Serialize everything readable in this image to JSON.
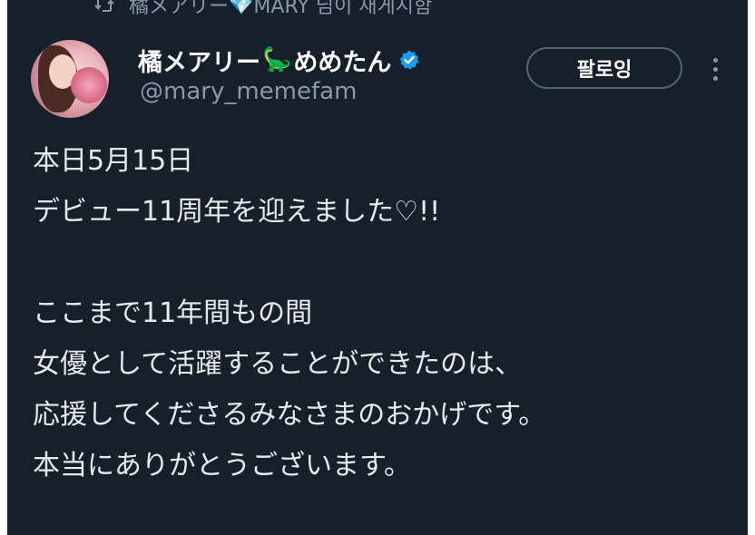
{
  "repost_banner": {
    "text_before": "橘メアリー",
    "gem_emoji": "💎",
    "text_after": "MARY 님이 재게시함"
  },
  "author": {
    "display_name": "橘メアリー",
    "name_emoji": "🦕",
    "display_name_suffix": "めめたん",
    "handle": "@mary_memefam",
    "verified": true,
    "verified_color": "#1d9bf0"
  },
  "actions": {
    "follow_label": "팔로잉"
  },
  "tweet": {
    "lines": [
      "本日5月15日",
      "デビュー11周年を迎えました♡!!",
      "",
      "ここまで11年間もの間",
      "女優として活躍することができたのは、",
      "応援してくださるみなさまのおかげです。",
      "本当にありがとうございます。"
    ]
  },
  "colors": {
    "background": "#15202b",
    "text": "#e7e9ea",
    "muted": "#8b98a5"
  }
}
